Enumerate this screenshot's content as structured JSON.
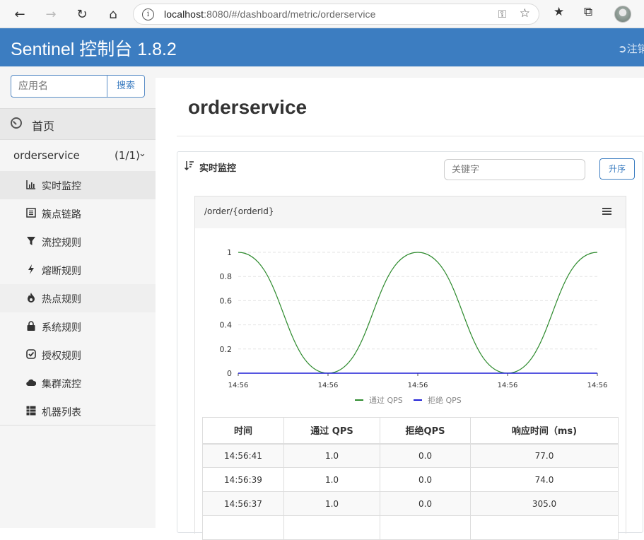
{
  "browser": {
    "url_host": "localhost",
    "url_rest": ":8080/#/dashboard/metric/orderservice"
  },
  "header": {
    "title": "Sentinel 控制台 1.8.2",
    "logout_label": "注销"
  },
  "sidebar": {
    "search_placeholder": "应用名",
    "search_button": "搜索",
    "home_label": "首页",
    "app_name": "orderservice",
    "app_count": "(1/1)",
    "menu": [
      {
        "label": "实时监控",
        "icon": "bar-chart-icon"
      },
      {
        "label": "簇点链路",
        "icon": "list-icon"
      },
      {
        "label": "流控规则",
        "icon": "filter-icon"
      },
      {
        "label": "熔断规则",
        "icon": "flash-icon"
      },
      {
        "label": "热点规则",
        "icon": "fire-icon"
      },
      {
        "label": "系统规则",
        "icon": "lock-icon"
      },
      {
        "label": "授权规则",
        "icon": "check-icon"
      },
      {
        "label": "集群流控",
        "icon": "cloud-icon"
      },
      {
        "label": "机器列表",
        "icon": "grid-icon"
      }
    ]
  },
  "main": {
    "page_title": "orderservice",
    "panel_title": "实时监控",
    "keyword_placeholder": "关键字",
    "sort_button": "升序",
    "resource": "/order/{orderId}",
    "table": {
      "headers": [
        "时间",
        "通过 QPS",
        "拒绝QPS",
        "响应时间（ms)"
      ],
      "rows": [
        [
          "14:56:41",
          "1.0",
          "0.0",
          "77.0"
        ],
        [
          "14:56:39",
          "1.0",
          "0.0",
          "74.0"
        ],
        [
          "14:56:37",
          "1.0",
          "0.0",
          "305.0"
        ]
      ]
    }
  },
  "chart_data": {
    "type": "line",
    "x": [
      "14:56",
      "14:56",
      "14:56",
      "14:56",
      "14:56"
    ],
    "ylim": [
      0,
      1
    ],
    "yticks": [
      "0",
      "0.2",
      "0.4",
      "0.6",
      "0.8",
      "1"
    ],
    "series": [
      {
        "name": "通过 QPS",
        "color": "#2e8b2e",
        "values": [
          1,
          0,
          1,
          0,
          1
        ]
      },
      {
        "name": "拒绝 QPS",
        "color": "#1f1fd6",
        "values": [
          0,
          0,
          0,
          0,
          0
        ]
      }
    ],
    "legend": "bottom",
    "grid": true
  }
}
